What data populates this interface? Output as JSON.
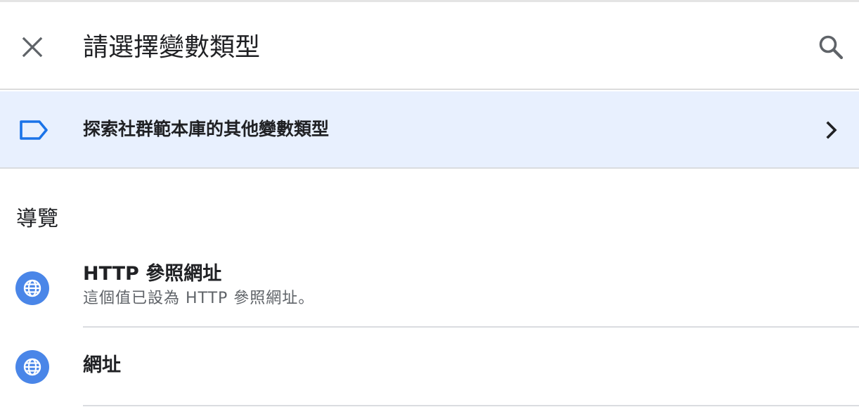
{
  "header": {
    "title": "請選擇變數類型",
    "close_icon": "close-icon",
    "search_icon": "search-icon"
  },
  "community": {
    "label": "探索社群範本庫的其他變數類型",
    "icon": "tag-icon",
    "chevron": "chevron-right-icon"
  },
  "section": {
    "title": "導覽",
    "items": [
      {
        "name": "HTTP 參照網址",
        "description": "這個值已設為 HTTP 參照網址。",
        "icon": "globe-icon"
      },
      {
        "name": "網址",
        "description": "",
        "icon": "globe-icon"
      }
    ]
  },
  "colors": {
    "accent_blue": "#4a86e8",
    "highlight_bg": "#e8f0fe",
    "tag_outline": "#1a73e8"
  }
}
